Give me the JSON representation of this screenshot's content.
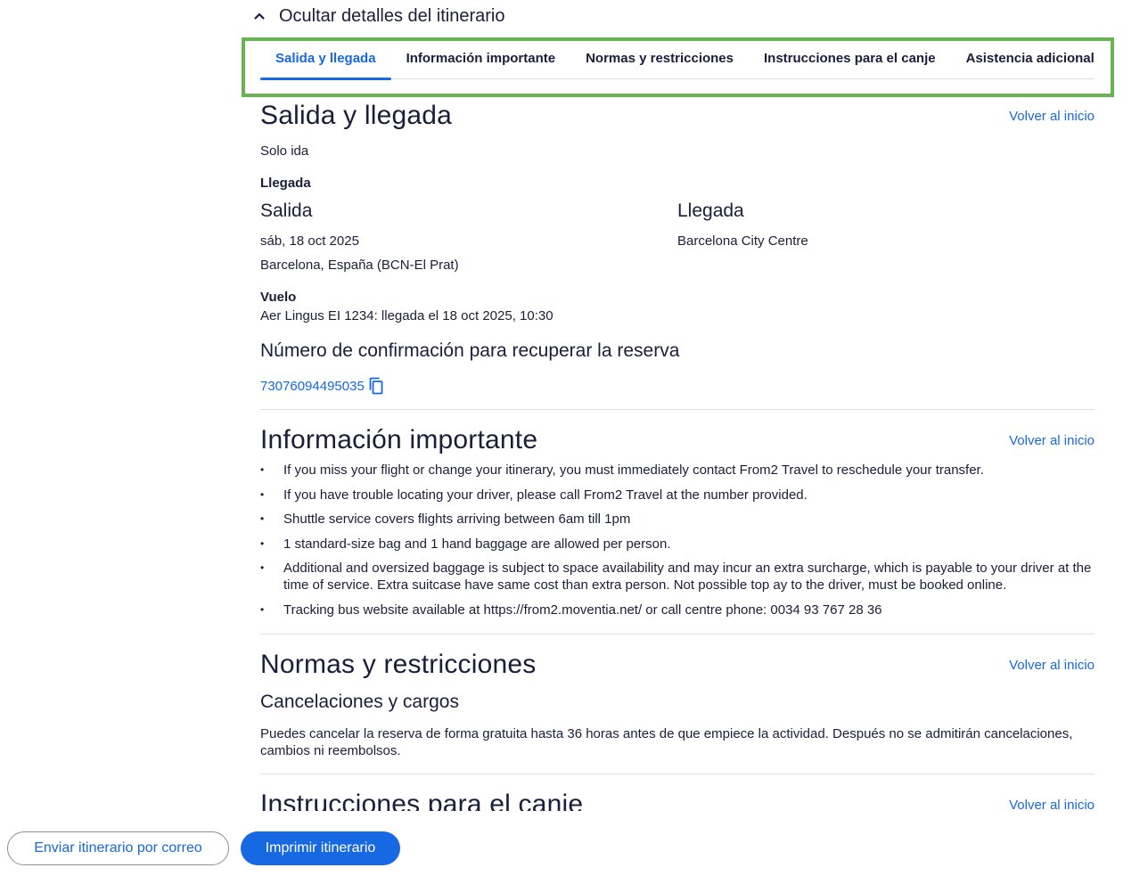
{
  "itinerary_toggle": {
    "label": "Ocultar detalles del itinerario",
    "icon": "chevron-up-icon"
  },
  "tabs": [
    {
      "label": "Salida y llegada",
      "active": true
    },
    {
      "label": "Información importante",
      "active": false
    },
    {
      "label": "Normas y restricciones",
      "active": false
    },
    {
      "label": "Instrucciones para el canje",
      "active": false
    },
    {
      "label": "Asistencia adicional",
      "active": false
    }
  ],
  "back_to_top": "Volver al inicio",
  "salida_llegada": {
    "title": "Salida y llegada",
    "trip_type": "Solo ida",
    "kind_label": "Llegada",
    "departure": {
      "heading": "Salida",
      "date": "sáb, 18 oct 2025",
      "place": "Barcelona, España (BCN-El Prat)"
    },
    "arrival": {
      "heading": "Llegada",
      "place": "Barcelona City Centre"
    },
    "flight": {
      "label": "Vuelo",
      "value": "Aer Lingus EI 1234: llegada el 18 oct 2025, 10:30"
    },
    "confirmation": {
      "heading": "Número de confirmación para recuperar la reserva",
      "number": "73076094495035",
      "icon": "copy-icon"
    }
  },
  "informacion": {
    "title": "Información importante",
    "items": [
      "If you miss your flight or change your itinerary, you must immediately contact From2 Travel to reschedule your transfer.",
      "If you have trouble locating your driver, please call From2 Travel at the number provided.",
      "Shuttle service covers flights arriving between 6am till 1pm",
      "1 standard-size bag and 1 hand baggage are allowed per person.",
      "Additional and oversized baggage is subject to space availability and may incur an extra surcharge, which is payable to your driver at the time of service. Extra suitcase have same cost than extra person. Not possible top ay to the driver, must be booked online.",
      "Tracking bus website available at https://from2.moventia.net/ or call centre phone: 0034 93 767 28 36"
    ]
  },
  "normas": {
    "title": "Normas y restricciones",
    "subtitle": "Cancelaciones y cargos",
    "text": "Puedes cancelar la reserva de forma gratuita hasta 36 horas antes de que empiece la actividad. Después no se admitirán cancelaciones, cambios ni reembolsos."
  },
  "instrucciones": {
    "title": "Instrucciones para el canje"
  },
  "footer": {
    "email_button": "Enviar itinerario por correo",
    "print_button": "Imprimir itinerario"
  },
  "colors": {
    "accent": "#1668e3",
    "text": "#191e3b",
    "highlight_frame": "#6ab352",
    "divider": "#dfe0e4"
  }
}
